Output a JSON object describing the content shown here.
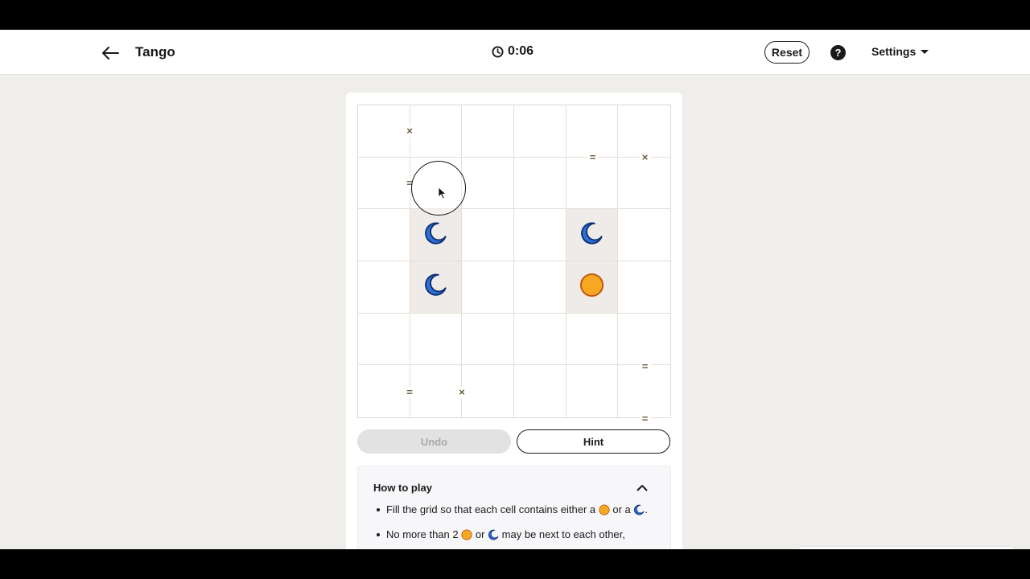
{
  "header": {
    "title": "Tango",
    "timer": "0:06",
    "reset_label": "Reset",
    "help_label": "?",
    "settings_label": "Settings",
    "icons": [
      "back-arrow-icon",
      "clock-icon",
      "help-icon",
      "caret-down-icon"
    ]
  },
  "board": {
    "rows": 6,
    "cols": 6,
    "cells": [
      [
        "",
        "",
        "",
        "",
        "",
        ""
      ],
      [
        "",
        "",
        "",
        "",
        "",
        ""
      ],
      [
        "",
        "moon",
        "",
        "",
        "moon",
        ""
      ],
      [
        "",
        "moon",
        "",
        "",
        "sun",
        ""
      ],
      [
        "",
        "",
        "",
        "",
        "",
        ""
      ],
      [
        "",
        "",
        "",
        "",
        "",
        ""
      ]
    ],
    "locked": [
      [
        2,
        1
      ],
      [
        2,
        4
      ],
      [
        3,
        1
      ],
      [
        3,
        4
      ]
    ],
    "constraints": [
      {
        "type": "x",
        "between": [
          [
            0,
            0
          ],
          [
            0,
            1
          ]
        ]
      },
      {
        "type": "=",
        "between": [
          [
            0,
            4
          ],
          [
            1,
            4
          ]
        ]
      },
      {
        "type": "x",
        "between": [
          [
            0,
            5
          ],
          [
            1,
            5
          ]
        ]
      },
      {
        "type": "=",
        "between": [
          [
            1,
            0
          ],
          [
            1,
            1
          ]
        ]
      },
      {
        "type": "=",
        "between": [
          [
            4,
            5
          ],
          [
            5,
            5
          ]
        ]
      },
      {
        "type": "=",
        "between": [
          [
            5,
            0
          ],
          [
            5,
            1
          ]
        ]
      },
      {
        "type": "x",
        "between": [
          [
            5,
            1
          ],
          [
            5,
            2
          ]
        ]
      },
      {
        "type": "=",
        "between": [
          [
            5,
            5
          ],
          [
            6,
            5
          ]
        ]
      }
    ],
    "sun_color": "#f7a823",
    "moon_color": "#2f6fd6"
  },
  "controls": {
    "undo_label": "Undo",
    "undo_enabled": false,
    "hint_label": "Hint"
  },
  "how_to_play": {
    "title": "How to play",
    "expanded": true,
    "rule1_a": "Fill the grid so that each cell contains either a",
    "rule1_b": "or a",
    "rule1_c": ".",
    "rule2_a": "No more than 2",
    "rule2_b": "or",
    "rule2_c": "may be next to each other,"
  }
}
